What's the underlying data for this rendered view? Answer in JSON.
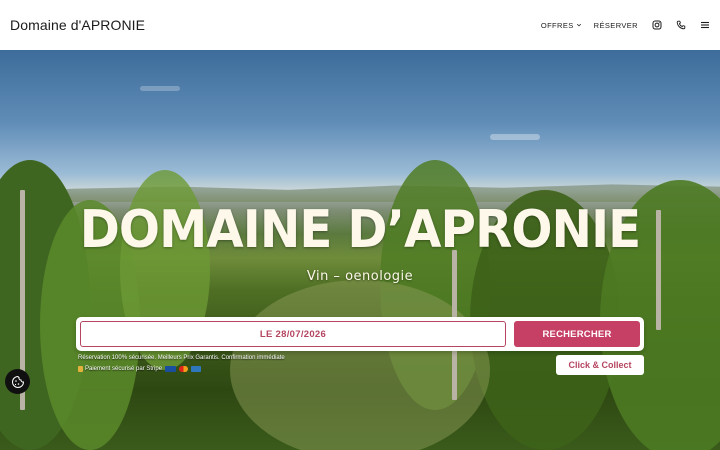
{
  "header": {
    "brand": "Domaine d'APRONIE",
    "nav": {
      "offers": "OFFRES",
      "reserve": "RÉSERVER"
    },
    "icons": [
      "instagram-icon",
      "phone-icon",
      "menu-icon"
    ]
  },
  "hero": {
    "title": "DOMAINE D’APRONIE",
    "subtitle": "Vin – oenologie"
  },
  "booking": {
    "date": "LE 28/07/2026",
    "search_label": "RECHERCHER",
    "secure_text": "Réservation 100% sécurisée. Meilleurs Prix Garantis. Confirmation immédiate",
    "payment_text": "Paiement sécurisé par Stripe"
  },
  "click_collect": "Click & Collect",
  "colors": {
    "accent": "#c63f64",
    "accent_text": "#b54561",
    "title": "#fdf8ea"
  }
}
